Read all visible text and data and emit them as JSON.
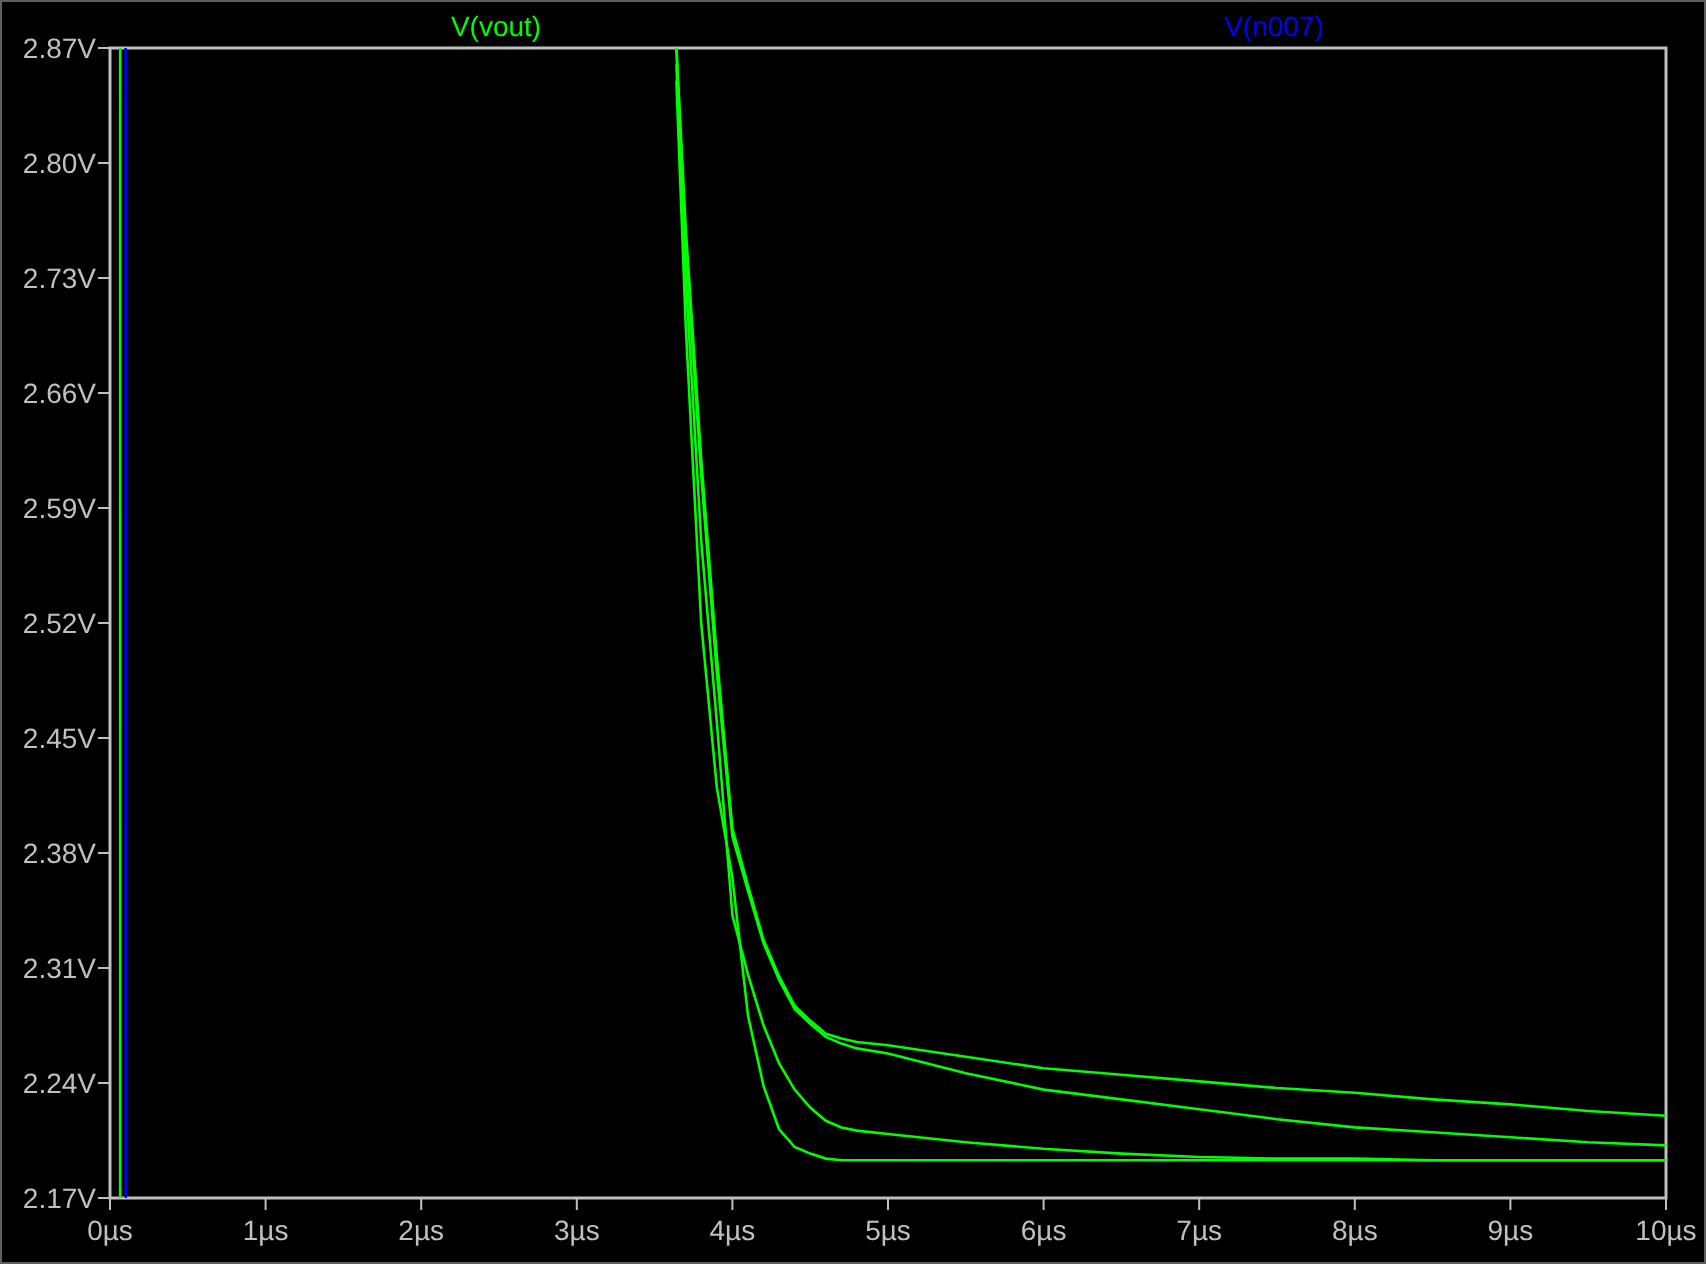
{
  "plot": {
    "chart_data": {
      "type": "line",
      "xlim": [
        0,
        10
      ],
      "ylim": [
        2.17,
        2.87
      ],
      "xticks": [
        {
          "value": 0,
          "label": "0µs"
        },
        {
          "value": 1,
          "label": "1µs"
        },
        {
          "value": 2,
          "label": "2µs"
        },
        {
          "value": 3,
          "label": "3µs"
        },
        {
          "value": 4,
          "label": "4µs"
        },
        {
          "value": 5,
          "label": "5µs"
        },
        {
          "value": 6,
          "label": "6µs"
        },
        {
          "value": 7,
          "label": "7µs"
        },
        {
          "value": 8,
          "label": "8µs"
        },
        {
          "value": 9,
          "label": "9µs"
        },
        {
          "value": 10,
          "label": "10µs"
        }
      ],
      "yticks": [
        {
          "value": 2.17,
          "label": "2.17V"
        },
        {
          "value": 2.24,
          "label": "2.24V"
        },
        {
          "value": 2.31,
          "label": "2.31V"
        },
        {
          "value": 2.38,
          "label": "2.38V"
        },
        {
          "value": 2.45,
          "label": "2.45V"
        },
        {
          "value": 2.52,
          "label": "2.52V"
        },
        {
          "value": 2.59,
          "label": "2.59V"
        },
        {
          "value": 2.66,
          "label": "2.66V"
        },
        {
          "value": 2.73,
          "label": "2.73V"
        },
        {
          "value": 2.8,
          "label": "2.80V"
        },
        {
          "value": 2.87,
          "label": "2.87V"
        }
      ],
      "x": [
        0.065,
        0.066,
        0.1,
        0.101,
        3.64,
        3.7,
        3.8,
        3.9,
        4.0,
        4.1,
        4.2,
        4.3,
        4.4,
        4.5,
        4.6,
        4.7,
        4.8,
        5,
        5.5,
        6,
        6.5,
        7,
        7.5,
        8,
        8.5,
        9,
        9.5,
        10
      ],
      "series": [
        {
          "name": "V(vout)",
          "color": "#00ff00",
          "values": [
            2.17,
            2.87,
            null,
            null,
            2.87,
            2.76,
            2.62,
            2.5,
            2.395,
            2.36,
            2.327,
            2.305,
            2.287,
            2.278,
            2.27,
            2.267,
            2.265,
            2.263,
            2.256,
            2.249,
            2.245,
            2.241,
            2.237,
            2.234,
            2.23,
            2.227,
            2.223,
            2.22
          ]
        },
        {
          "color": "#00ff00",
          "values": [
            null,
            null,
            null,
            null,
            2.87,
            2.75,
            2.61,
            2.49,
            2.39,
            2.357,
            2.325,
            2.303,
            2.285,
            2.276,
            2.268,
            2.264,
            2.261,
            2.258,
            2.246,
            2.236,
            2.23,
            2.224,
            2.218,
            2.213,
            2.21,
            2.207,
            2.204,
            2.202
          ]
        },
        {
          "color": "#00ff00",
          "values": [
            null,
            null,
            null,
            null,
            2.86,
            2.73,
            2.57,
            2.46,
            2.342,
            2.306,
            2.275,
            2.252,
            2.236,
            2.225,
            2.217,
            2.213,
            2.211,
            2.209,
            2.204,
            2.2,
            2.197,
            2.195,
            2.194,
            2.194,
            2.193,
            2.193,
            2.193,
            2.193
          ]
        },
        {
          "color": "#00ff00",
          "values": [
            null,
            null,
            null,
            null,
            2.85,
            2.7,
            2.52,
            2.42,
            2.365,
            2.281,
            2.238,
            2.212,
            2.201,
            2.197,
            2.194,
            2.193,
            2.193,
            2.193,
            2.193,
            2.193,
            2.193,
            2.193,
            2.193,
            2.193,
            2.193,
            2.193,
            2.193,
            2.193
          ]
        },
        {
          "name": "V(n007)",
          "color": "#0000ff",
          "values": [
            null,
            null,
            2.87,
            2.17,
            null,
            null,
            null,
            null,
            null,
            null,
            null,
            null,
            null,
            null,
            null,
            null,
            null,
            null,
            null,
            null,
            null,
            null,
            null,
            null,
            null,
            null,
            null,
            null
          ]
        }
      ]
    }
  }
}
